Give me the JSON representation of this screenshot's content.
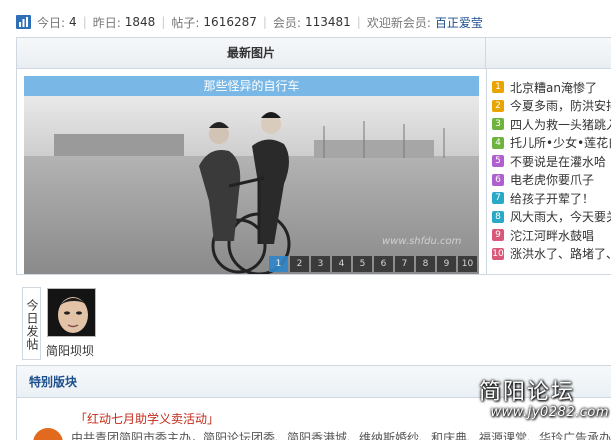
{
  "stats": {
    "today_label": "今日:",
    "today": "4",
    "yesterday_label": "昨日:",
    "yesterday": "1848",
    "posts_label": "帖子:",
    "posts": "1616287",
    "members_label": "会员:",
    "members": "113481",
    "newmember_label": "欢迎新会员:",
    "newmember": "百正爱莹",
    "icon": "bar-chart-icon"
  },
  "gallery": {
    "header": "最新图片",
    "caption": "那些怪异的自行车",
    "watermark": "www.shfdu.com",
    "pages": [
      "1",
      "2",
      "3",
      "4",
      "5",
      "6",
      "7",
      "8",
      "9",
      "10"
    ],
    "active_page": 1
  },
  "news": [
    {
      "n": "1",
      "color": "#e8a400",
      "title": "北京糟an淹惨了"
    },
    {
      "n": "2",
      "color": "#e8a400",
      "title": "今夏多雨，防洪安排"
    },
    {
      "n": "3",
      "color": "#6fb33f",
      "title": "四人为救一头猪跳入"
    },
    {
      "n": "4",
      "color": "#6fb33f",
      "title": "托儿所•少女•莲花白"
    },
    {
      "n": "5",
      "color": "#b05fcf",
      "title": "不要说是在灌水哈"
    },
    {
      "n": "6",
      "color": "#b05fcf",
      "title": "电老虎你要爪子"
    },
    {
      "n": "7",
      "color": "#2aa8c8",
      "title": "给孩子开荤了！"
    },
    {
      "n": "8",
      "color": "#2aa8c8",
      "title": "风大雨大，今天要关"
    },
    {
      "n": "9",
      "color": "#d9587a",
      "title": "沱江河畔水鼓唱"
    },
    {
      "n": "10",
      "color": "#d9587a",
      "title": "涨洪水了、路堵了、"
    }
  ],
  "today_posters": {
    "label": "今日发帖",
    "user": "简阳坝坝"
  },
  "special": {
    "header": "特别版块",
    "brand": "简阳论坛",
    "site": "www.jy0282.com",
    "event_title": "「红动七月助学义卖活动」",
    "event_desc": "由共青团简阳市委主办，简阳论坛团委、简阳香港城、维纳斯婚纱、和庆典、福源课堂、华玲广告承办"
  }
}
